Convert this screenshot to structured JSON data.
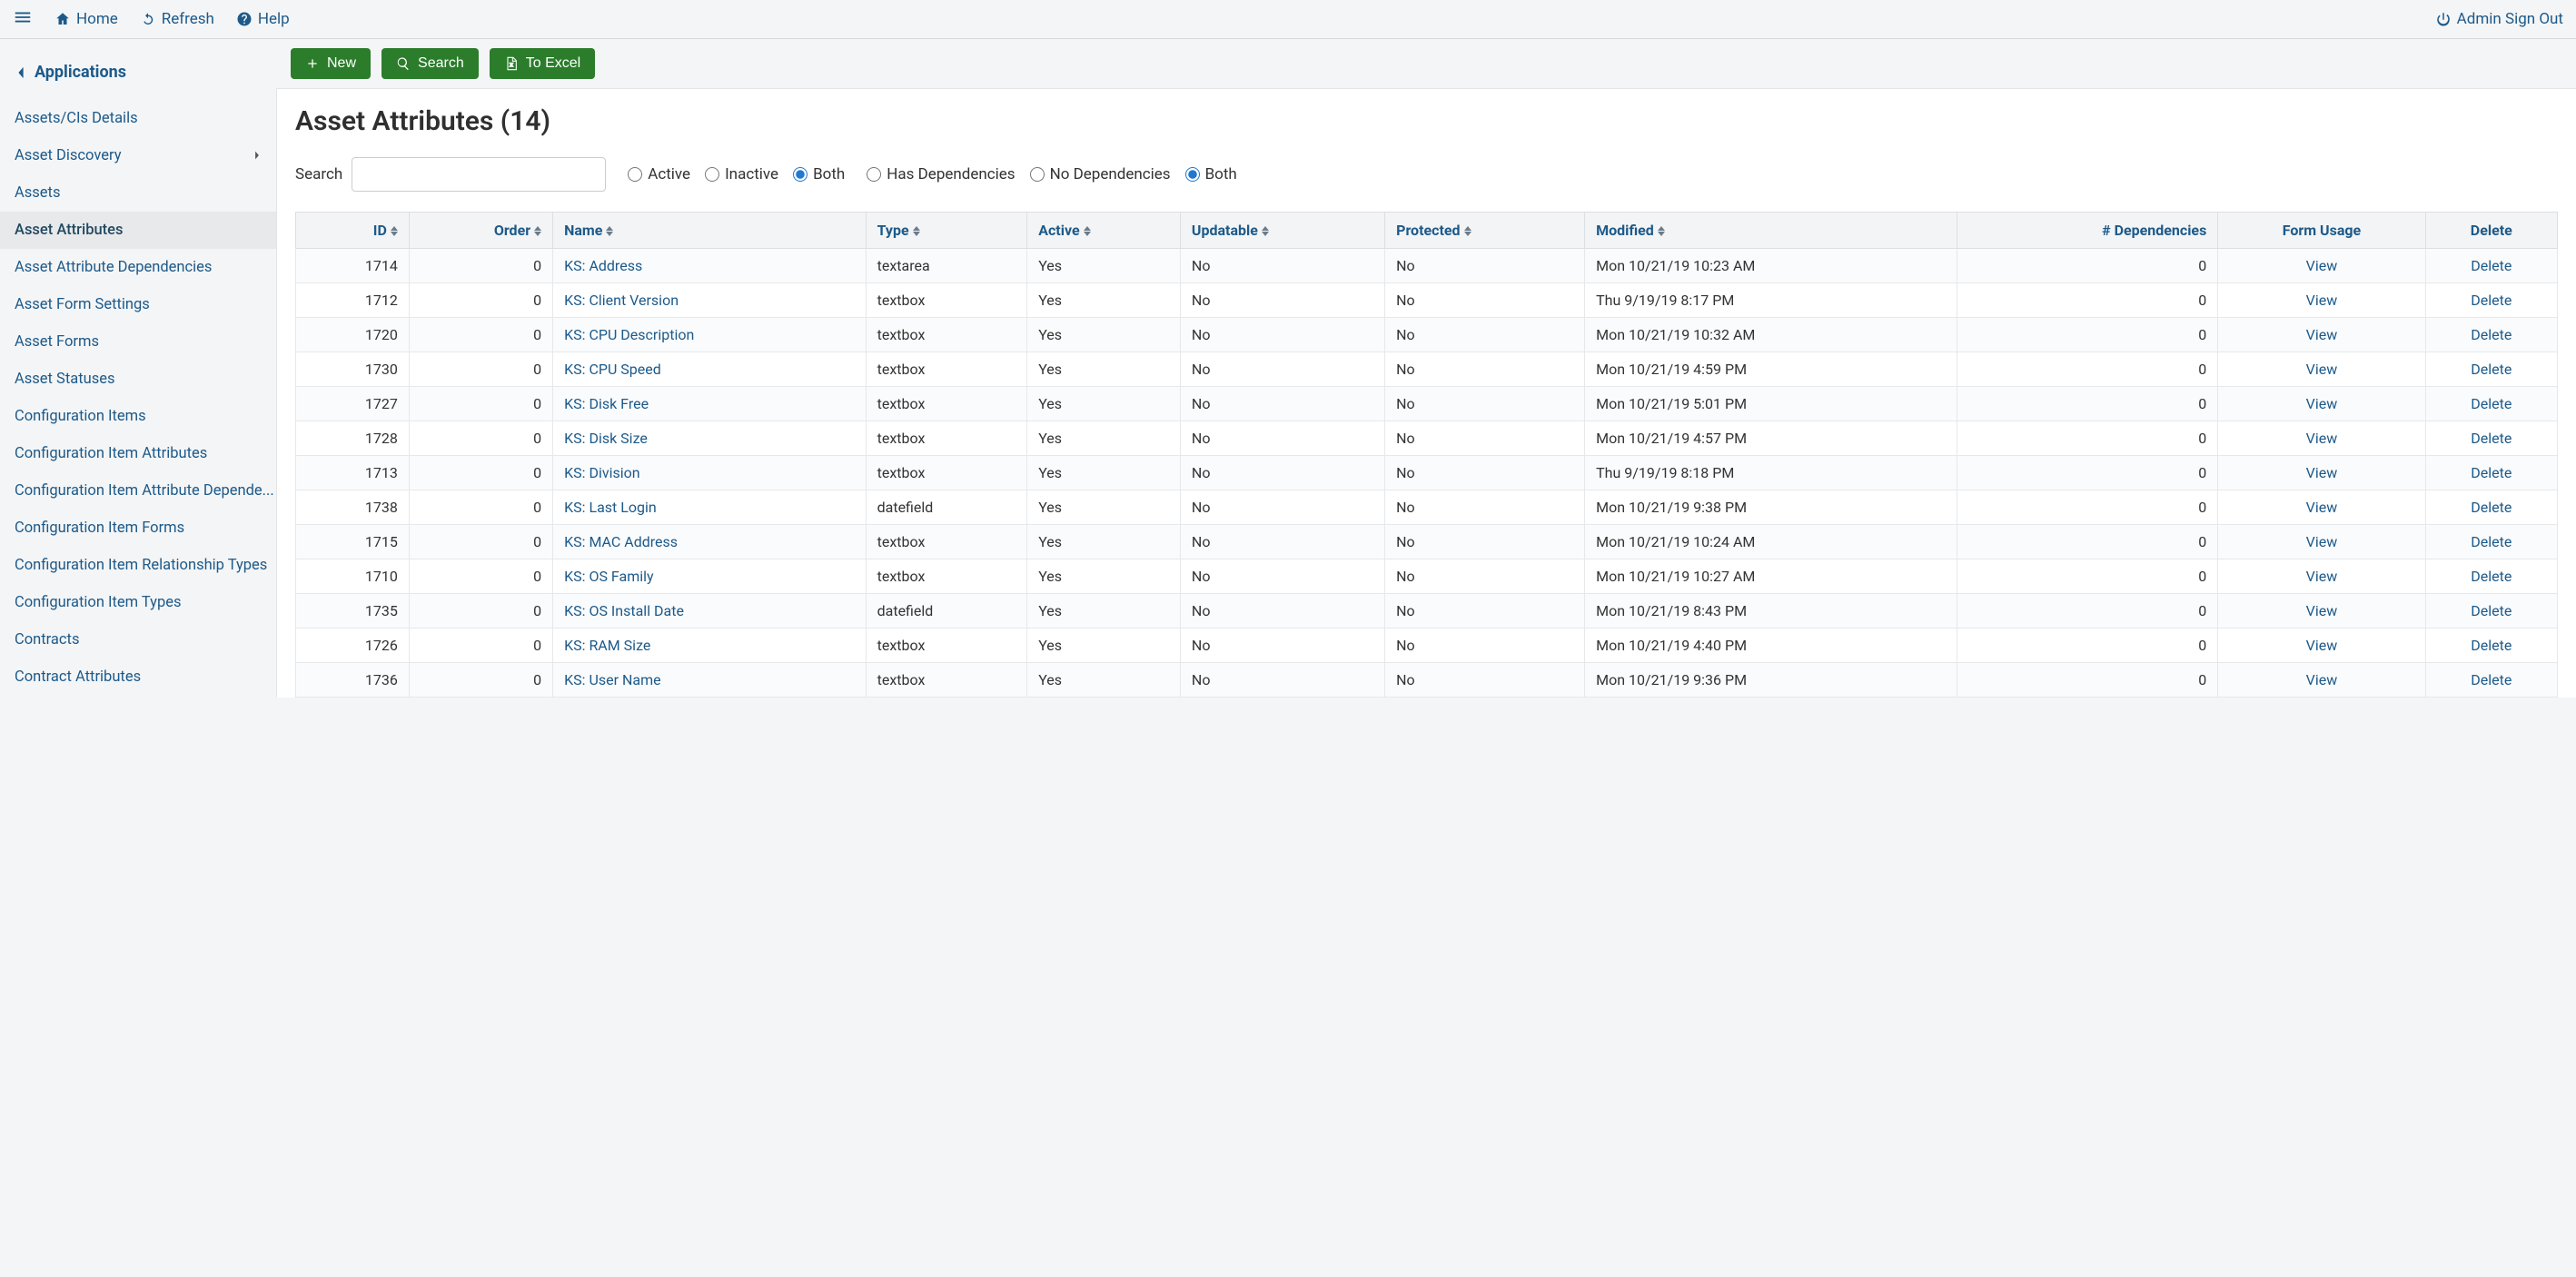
{
  "topbar": {
    "home": "Home",
    "refresh": "Refresh",
    "help": "Help",
    "signout": "Admin Sign Out"
  },
  "actions": {
    "new": "New",
    "search": "Search",
    "excel": "To Excel"
  },
  "sidebar": {
    "header": "Applications",
    "items": [
      {
        "label": "Assets/CIs Details",
        "active": false,
        "hasChildren": false
      },
      {
        "label": "Asset Discovery",
        "active": false,
        "hasChildren": true
      },
      {
        "label": "Assets",
        "active": false,
        "hasChildren": false
      },
      {
        "label": "Asset Attributes",
        "active": true,
        "hasChildren": false
      },
      {
        "label": "Asset Attribute Dependencies",
        "active": false,
        "hasChildren": false
      },
      {
        "label": "Asset Form Settings",
        "active": false,
        "hasChildren": false
      },
      {
        "label": "Asset Forms",
        "active": false,
        "hasChildren": false
      },
      {
        "label": "Asset Statuses",
        "active": false,
        "hasChildren": false
      },
      {
        "label": "Configuration Items",
        "active": false,
        "hasChildren": false
      },
      {
        "label": "Configuration Item Attributes",
        "active": false,
        "hasChildren": false
      },
      {
        "label": "Configuration Item Attribute Depende...",
        "active": false,
        "hasChildren": false
      },
      {
        "label": "Configuration Item Forms",
        "active": false,
        "hasChildren": false
      },
      {
        "label": "Configuration Item Relationship Types",
        "active": false,
        "hasChildren": false
      },
      {
        "label": "Configuration Item Types",
        "active": false,
        "hasChildren": false
      },
      {
        "label": "Contracts",
        "active": false,
        "hasChildren": false
      },
      {
        "label": "Contract Attributes",
        "active": false,
        "hasChildren": false
      }
    ]
  },
  "page": {
    "title": "Asset Attributes (14)",
    "search_label": "Search"
  },
  "filters": {
    "status": {
      "options": [
        "Active",
        "Inactive",
        "Both"
      ],
      "selected": "Both"
    },
    "deps": {
      "options": [
        "Has Dependencies",
        "No Dependencies",
        "Both"
      ],
      "selected": "Both"
    }
  },
  "table": {
    "columns": [
      {
        "key": "id",
        "label": "ID",
        "sortable": true,
        "align": "r"
      },
      {
        "key": "order",
        "label": "Order",
        "sortable": true,
        "align": "r"
      },
      {
        "key": "name",
        "label": "Name",
        "sortable": true,
        "align": "l"
      },
      {
        "key": "type",
        "label": "Type",
        "sortable": true,
        "align": "l"
      },
      {
        "key": "active",
        "label": "Active",
        "sortable": true,
        "align": "l"
      },
      {
        "key": "updatable",
        "label": "Updatable",
        "sortable": true,
        "align": "l"
      },
      {
        "key": "protected",
        "label": "Protected",
        "sortable": true,
        "align": "l"
      },
      {
        "key": "modified",
        "label": "Modified",
        "sortable": true,
        "align": "l"
      },
      {
        "key": "deps",
        "label": "# Dependencies",
        "sortable": false,
        "align": "r"
      },
      {
        "key": "form",
        "label": "Form Usage",
        "sortable": false,
        "align": "c"
      },
      {
        "key": "del",
        "label": "Delete",
        "sortable": false,
        "align": "c"
      }
    ],
    "view_label": "View",
    "delete_label": "Delete",
    "rows": [
      {
        "id": "1714",
        "order": "0",
        "name": "KS: Address",
        "type": "textarea",
        "active": "Yes",
        "updatable": "No",
        "protected": "No",
        "modified": "Mon 10/21/19 10:23 AM",
        "deps": "0"
      },
      {
        "id": "1712",
        "order": "0",
        "name": "KS: Client Version",
        "type": "textbox",
        "active": "Yes",
        "updatable": "No",
        "protected": "No",
        "modified": "Thu 9/19/19 8:17 PM",
        "deps": "0"
      },
      {
        "id": "1720",
        "order": "0",
        "name": "KS: CPU Description",
        "type": "textbox",
        "active": "Yes",
        "updatable": "No",
        "protected": "No",
        "modified": "Mon 10/21/19 10:32 AM",
        "deps": "0"
      },
      {
        "id": "1730",
        "order": "0",
        "name": "KS: CPU Speed",
        "type": "textbox",
        "active": "Yes",
        "updatable": "No",
        "protected": "No",
        "modified": "Mon 10/21/19 4:59 PM",
        "deps": "0"
      },
      {
        "id": "1727",
        "order": "0",
        "name": "KS: Disk Free",
        "type": "textbox",
        "active": "Yes",
        "updatable": "No",
        "protected": "No",
        "modified": "Mon 10/21/19 5:01 PM",
        "deps": "0"
      },
      {
        "id": "1728",
        "order": "0",
        "name": "KS: Disk Size",
        "type": "textbox",
        "active": "Yes",
        "updatable": "No",
        "protected": "No",
        "modified": "Mon 10/21/19 4:57 PM",
        "deps": "0"
      },
      {
        "id": "1713",
        "order": "0",
        "name": "KS: Division",
        "type": "textbox",
        "active": "Yes",
        "updatable": "No",
        "protected": "No",
        "modified": "Thu 9/19/19 8:18 PM",
        "deps": "0"
      },
      {
        "id": "1738",
        "order": "0",
        "name": "KS: Last Login",
        "type": "datefield",
        "active": "Yes",
        "updatable": "No",
        "protected": "No",
        "modified": "Mon 10/21/19 9:38 PM",
        "deps": "0"
      },
      {
        "id": "1715",
        "order": "0",
        "name": "KS: MAC Address",
        "type": "textbox",
        "active": "Yes",
        "updatable": "No",
        "protected": "No",
        "modified": "Mon 10/21/19 10:24 AM",
        "deps": "0"
      },
      {
        "id": "1710",
        "order": "0",
        "name": "KS: OS Family",
        "type": "textbox",
        "active": "Yes",
        "updatable": "No",
        "protected": "No",
        "modified": "Mon 10/21/19 10:27 AM",
        "deps": "0"
      },
      {
        "id": "1735",
        "order": "0",
        "name": "KS: OS Install Date",
        "type": "datefield",
        "active": "Yes",
        "updatable": "No",
        "protected": "No",
        "modified": "Mon 10/21/19 8:43 PM",
        "deps": "0"
      },
      {
        "id": "1726",
        "order": "0",
        "name": "KS: RAM Size",
        "type": "textbox",
        "active": "Yes",
        "updatable": "No",
        "protected": "No",
        "modified": "Mon 10/21/19 4:40 PM",
        "deps": "0"
      },
      {
        "id": "1736",
        "order": "0",
        "name": "KS: User Name",
        "type": "textbox",
        "active": "Yes",
        "updatable": "No",
        "protected": "No",
        "modified": "Mon 10/21/19 9:36 PM",
        "deps": "0"
      }
    ]
  }
}
